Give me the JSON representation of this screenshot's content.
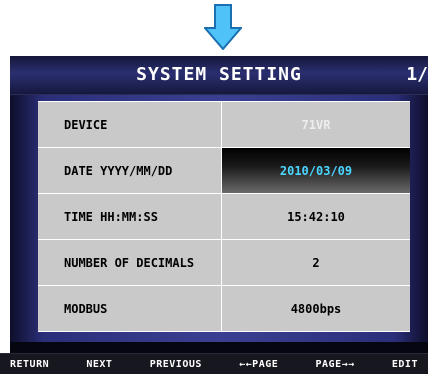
{
  "header": {
    "title": "SYSTEM SETTING",
    "page": "1/"
  },
  "settings": [
    {
      "label": "DEVICE",
      "value": "71VR"
    },
    {
      "label": "DATE YYYY/MM/DD",
      "value": "2010/03/09"
    },
    {
      "label": "TIME HH:MM:SS",
      "value": "15:42:10"
    },
    {
      "label": "NUMBER OF DECIMALS",
      "value": "2"
    },
    {
      "label": "MODBUS",
      "value": "4800bps"
    }
  ],
  "footer": {
    "keys": [
      "RETURN",
      "NEXT",
      "PREVIOUS",
      "←←PAGE",
      "PAGE→→",
      "EDIT"
    ]
  },
  "colors": {
    "arrow": "#4fc3f7",
    "selected_text": "#49d6ff",
    "cell": "#c9c9c9"
  }
}
